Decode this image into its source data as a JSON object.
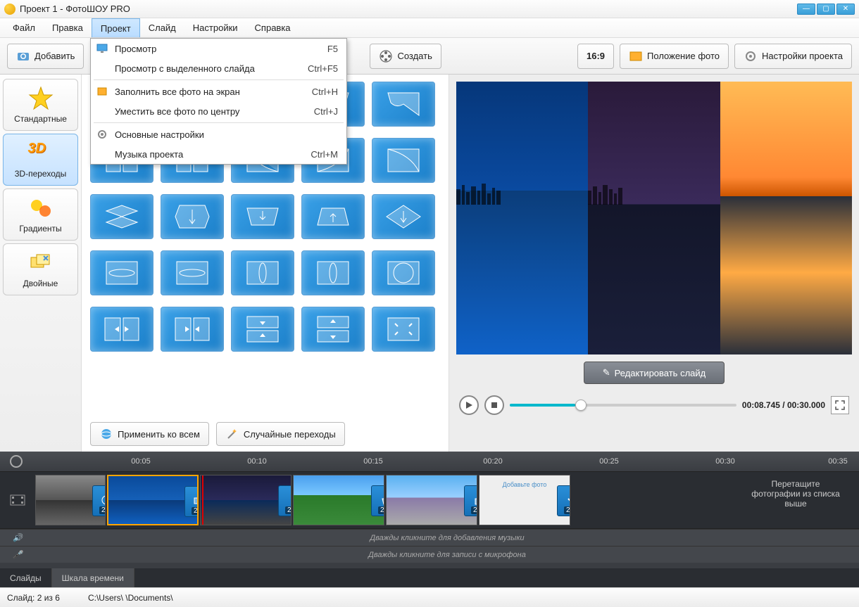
{
  "window": {
    "title": "Проект 1 - ФотоШОУ PRO"
  },
  "menu": {
    "items": [
      "Файл",
      "Правка",
      "Проект",
      "Слайд",
      "Настройки",
      "Справка"
    ],
    "active": "Проект",
    "dropdown": [
      {
        "label": "Просмотр",
        "shortcut": "F5",
        "icon": "monitor-icon"
      },
      {
        "label": "Просмотр с выделенного слайда",
        "shortcut": "Ctrl+F5"
      },
      {
        "sep": true
      },
      {
        "label": "Заполнить все фото на экран",
        "shortcut": "Ctrl+H",
        "icon": "fill-icon"
      },
      {
        "label": "Уместить все фото по центру",
        "shortcut": "Ctrl+J"
      },
      {
        "sep": true
      },
      {
        "label": "Основные настройки",
        "icon": "gear-icon"
      },
      {
        "label": "Музыка проекта",
        "shortcut": "Ctrl+M"
      }
    ]
  },
  "toolbar": {
    "add": "Добавить",
    "create": "Создать",
    "aspect": "16:9",
    "photo_position": "Положение фото",
    "project_settings": "Настройки проекта"
  },
  "categories": [
    {
      "label": "Стандартные",
      "icon": "star"
    },
    {
      "label": "3D-переходы",
      "icon": "3d",
      "selected": true
    },
    {
      "label": "Градиенты",
      "icon": "gradient"
    },
    {
      "label": "Двойные",
      "icon": "double"
    }
  ],
  "transitions_actions": {
    "apply_all": "Применить ко всем",
    "random": "Случайные переходы"
  },
  "preview": {
    "edit_slide": "Редактировать слайд",
    "time": "00:08.745 / 00:30.000"
  },
  "timeline": {
    "ticks": [
      "00:05",
      "00:10",
      "00:15",
      "00:20",
      "00:25",
      "00:30",
      "00:35"
    ],
    "transition_duration": "2.0",
    "drop_hint": "Перетащите фотографии из списка выше",
    "music_hint": "Дважды кликните для добавления музыки",
    "mic_hint": "Дважды кликните для записи с микрофона",
    "add_photo": "Добавьте фото"
  },
  "tabs": {
    "slides": "Слайды",
    "timeline": "Шкала времени"
  },
  "status": {
    "slide": "Слайд: 2 из 6",
    "path": "C:\\Users\\        \\Documents\\"
  }
}
